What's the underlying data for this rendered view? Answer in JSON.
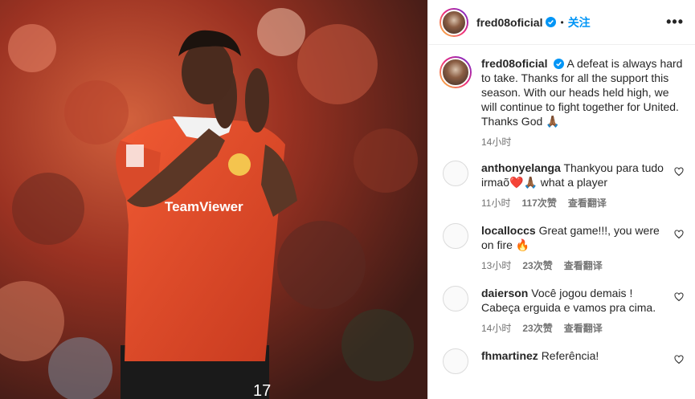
{
  "post": {
    "username": "fred08oficial",
    "follow_label": "关注",
    "more_label": "•••",
    "caption": "A defeat is always hard to take. Thanks for all the support this season. With our heads held high, we will continue to fight together for United. Thanks God 🙏🏾",
    "caption_time": "14小时"
  },
  "comments": [
    {
      "user": "anthonyelanga",
      "text": "Thankyou para tudo irmaõ❤️🙏🏾 what a player",
      "time": "11小时",
      "likes": "117次赞",
      "translate": "查看翻译"
    },
    {
      "user": "localloccs",
      "text": "Great game!!!, you were on fire 🔥",
      "time": "13小时",
      "likes": "23次赞",
      "translate": "查看翻译"
    },
    {
      "user": "daierson",
      "text": "Você jogou demais ! Cabeça erguida e vamos pra cima.",
      "time": "14小时",
      "likes": "23次赞",
      "translate": "查看翻译"
    },
    {
      "user": "fhmartinez",
      "text": "Referência!",
      "time": "",
      "likes": "",
      "translate": ""
    }
  ],
  "photo": {
    "shirt_sponsor": "TeamViewer",
    "shirt_number": "17"
  },
  "colors": {
    "accent": "#0095f6",
    "shirt": "#e0472a",
    "verified": "#0095f6"
  },
  "icons": [
    "verified-badge-icon",
    "more-options-icon",
    "heart-icon"
  ]
}
